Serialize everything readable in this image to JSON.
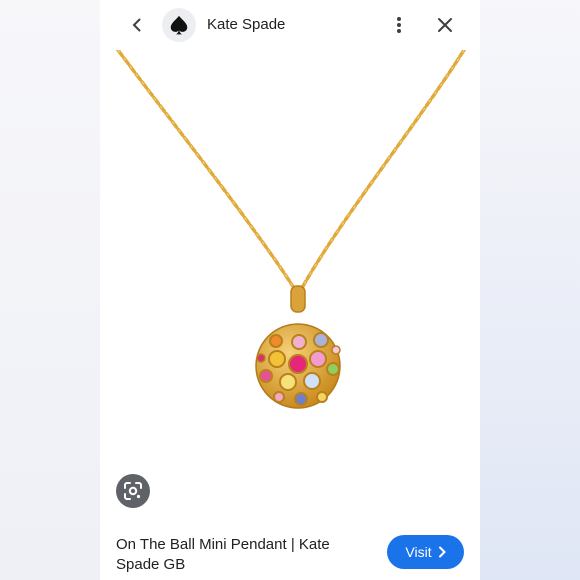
{
  "header": {
    "site_name": "Kate Spade",
    "back_icon": "chevron-left-icon",
    "logo_icon": "spade-icon",
    "more_icon": "more-vertical-icon",
    "close_icon": "close-icon"
  },
  "image": {
    "subject": "gold chain pendant necklace with rainbow crystal ball"
  },
  "lens": {
    "icon": "google-lens-icon"
  },
  "footer": {
    "product_title": "On The Ball Mini Pendant | Kate Spade GB",
    "visit_label": "Visit",
    "visit_icon": "chevron-right-icon"
  },
  "colors": {
    "accent": "#1a73e8",
    "gold": "#e5b24a"
  }
}
